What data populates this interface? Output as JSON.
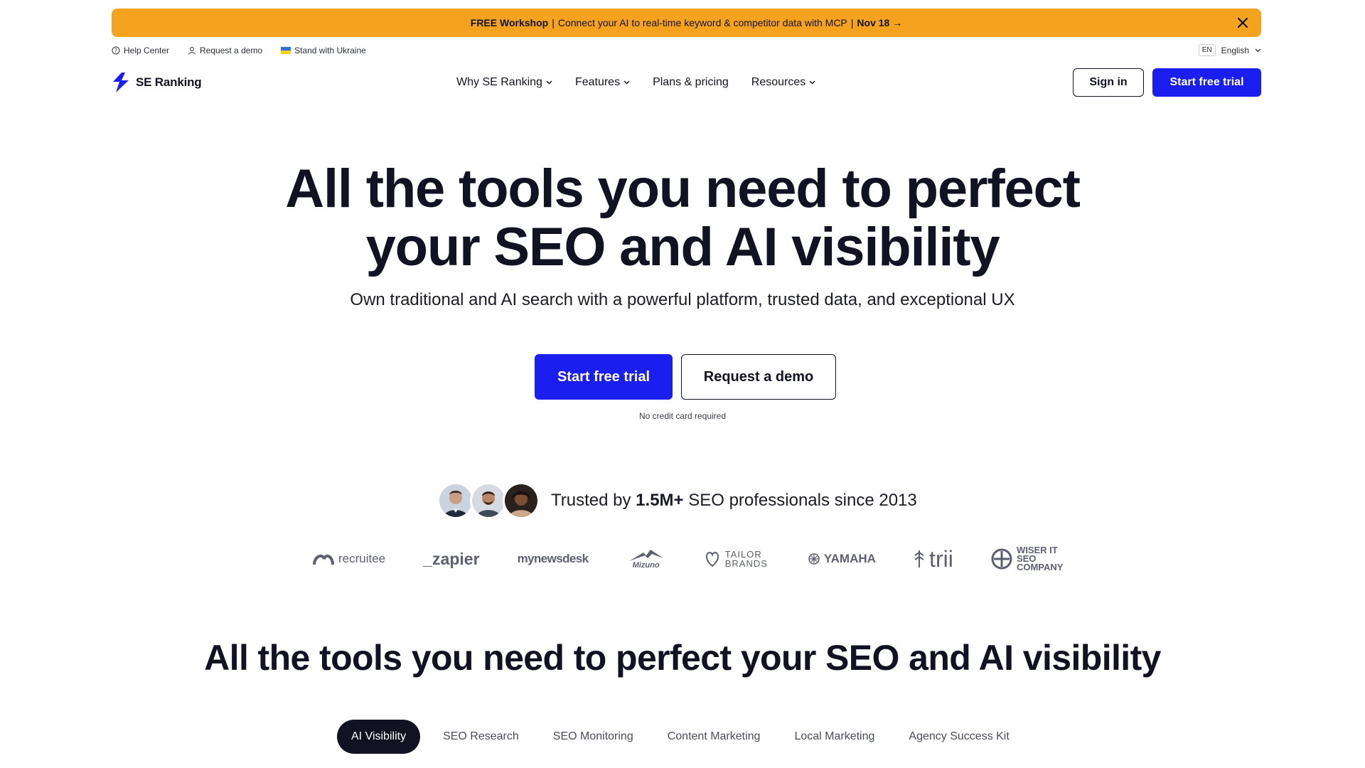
{
  "promo": {
    "free": "FREE Workshop",
    "sep1": "|",
    "message": "Connect your AI to real-time keyword & competitor data with MCP",
    "sep2": "|",
    "date": "Nov 18 →"
  },
  "utility": {
    "help_center": "Help Center",
    "request_demo": "Request a demo",
    "ukraine": "Stand with Ukraine",
    "lang_code": "EN",
    "language": "English"
  },
  "nav": {
    "logo_text": "SE Ranking",
    "menu": [
      {
        "label": "Why SE Ranking"
      },
      {
        "label": "Features"
      },
      {
        "label": "Plans & pricing"
      },
      {
        "label": "Resources"
      }
    ],
    "sign_in": "Sign in",
    "start_trial": "Start free trial"
  },
  "hero": {
    "title_line1": "All the tools you need to perfect",
    "title_line2": "your SEO and AI visibility",
    "subtitle": "Own traditional and AI search with a powerful platform, trusted data, and exceptional UX",
    "primary_cta": "Start free trial",
    "secondary_cta": "Request a demo",
    "note": "No credit card required"
  },
  "trusted": {
    "prefix": "Trusted by",
    "count": "1.5M+",
    "suffix": "SEO professionals since 2013"
  },
  "logos": [
    "recruitee",
    "_zapier",
    "mynewsdesk",
    "Mizuno",
    "TAILOR BRANDS",
    "YAMAHA",
    "trii",
    "WISER IT SEO COMPANY"
  ],
  "section": {
    "title": "All the tools you need to perfect your SEO and AI visibility",
    "tabs": [
      {
        "label": "AI Visibility"
      },
      {
        "label": "SEO Research"
      },
      {
        "label": "SEO Monitoring"
      },
      {
        "label": "Content Marketing"
      },
      {
        "label": "Local Marketing"
      },
      {
        "label": "Agency Success Kit"
      }
    ]
  },
  "colors": {
    "accent": "#1a1ff0",
    "banner": "#f5a21f",
    "text": "#111322"
  }
}
